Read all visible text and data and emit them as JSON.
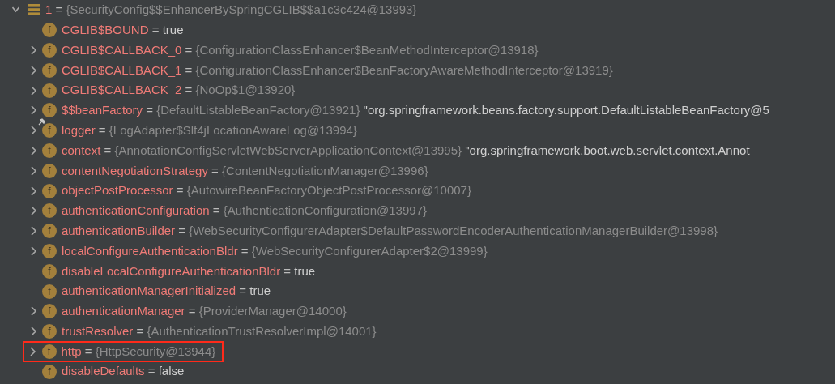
{
  "root": {
    "index": "1",
    "separator": "=",
    "object": "{SecurityConfig$$EnhancerBySpringCGLIB$$a1c3c424@13993}",
    "expanded": true,
    "children": [
      {
        "icon": "f",
        "name": "CGLIB$BOUND",
        "separator": "=",
        "value": "true",
        "expandable": false,
        "pinned": false,
        "highlighted": false
      },
      {
        "icon": "f",
        "name": "CGLIB$CALLBACK_0",
        "separator": "=",
        "object": "{ConfigurationClassEnhancer$BeanMethodInterceptor@13918}",
        "expandable": true,
        "pinned": false,
        "highlighted": false
      },
      {
        "icon": "f",
        "name": "CGLIB$CALLBACK_1",
        "separator": "=",
        "object": "{ConfigurationClassEnhancer$BeanFactoryAwareMethodInterceptor@13919}",
        "expandable": true,
        "pinned": false,
        "highlighted": false
      },
      {
        "icon": "f",
        "name": "CGLIB$CALLBACK_2",
        "separator": "=",
        "object": "{NoOp$1@13920}",
        "expandable": true,
        "pinned": false,
        "highlighted": false
      },
      {
        "icon": "f",
        "name": "$$beanFactory",
        "separator": "=",
        "object": "{DefaultListableBeanFactory@13921}",
        "value": "\"org.springframework.beans.factory.support.DefaultListableBeanFactory@5",
        "expandable": true,
        "pinned": false,
        "highlighted": false
      },
      {
        "icon": "f",
        "name": "logger",
        "separator": "=",
        "object": "{LogAdapter$Slf4jLocationAwareLog@13994}",
        "expandable": true,
        "pinned": true,
        "highlighted": false
      },
      {
        "icon": "f",
        "name": "context",
        "separator": "=",
        "object": "{AnnotationConfigServletWebServerApplicationContext@13995}",
        "value": "\"org.springframework.boot.web.servlet.context.Annot",
        "expandable": true,
        "pinned": false,
        "highlighted": false
      },
      {
        "icon": "f",
        "name": "contentNegotiationStrategy",
        "separator": "=",
        "object": "{ContentNegotiationManager@13996}",
        "expandable": true,
        "pinned": false,
        "highlighted": false
      },
      {
        "icon": "f",
        "name": "objectPostProcessor",
        "separator": "=",
        "object": "{AutowireBeanFactoryObjectPostProcessor@10007}",
        "expandable": true,
        "pinned": false,
        "highlighted": false
      },
      {
        "icon": "f",
        "name": "authenticationConfiguration",
        "separator": "=",
        "object": "{AuthenticationConfiguration@13997}",
        "expandable": true,
        "pinned": false,
        "highlighted": false
      },
      {
        "icon": "f",
        "name": "authenticationBuilder",
        "separator": "=",
        "object": "{WebSecurityConfigurerAdapter$DefaultPasswordEncoderAuthenticationManagerBuilder@13998}",
        "expandable": true,
        "pinned": false,
        "highlighted": false
      },
      {
        "icon": "f",
        "name": "localConfigureAuthenticationBldr",
        "separator": "=",
        "object": "{WebSecurityConfigurerAdapter$2@13999}",
        "expandable": true,
        "pinned": false,
        "highlighted": false
      },
      {
        "icon": "f",
        "name": "disableLocalConfigureAuthenticationBldr",
        "separator": "=",
        "value": "true",
        "expandable": false,
        "pinned": false,
        "highlighted": false
      },
      {
        "icon": "f",
        "name": "authenticationManagerInitialized",
        "separator": "=",
        "value": "true",
        "expandable": false,
        "pinned": false,
        "highlighted": false
      },
      {
        "icon": "f",
        "name": "authenticationManager",
        "separator": "=",
        "object": "{ProviderManager@14000}",
        "expandable": true,
        "pinned": false,
        "highlighted": false
      },
      {
        "icon": "f",
        "name": "trustResolver",
        "separator": "=",
        "object": "{AuthenticationTrustResolverImpl@14001}",
        "expandable": true,
        "pinned": false,
        "highlighted": false
      },
      {
        "icon": "f",
        "name": "http",
        "separator": "=",
        "object": "{HttpSecurity@13944}",
        "expandable": true,
        "pinned": false,
        "highlighted": true
      },
      {
        "icon": "f",
        "name": "disableDefaults",
        "separator": "=",
        "value": "false",
        "expandable": false,
        "pinned": false,
        "highlighted": false
      }
    ]
  }
}
